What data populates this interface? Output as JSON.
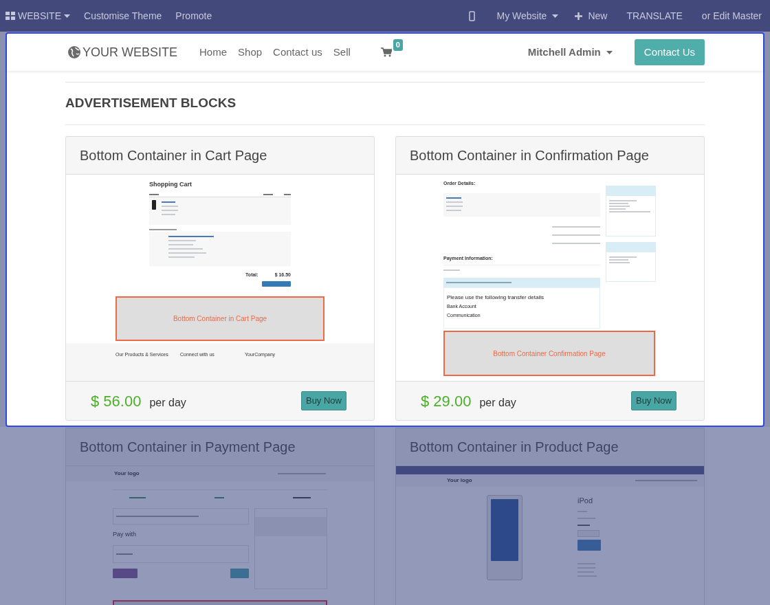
{
  "editor_bar": {
    "app_menu": "WEBSITE",
    "left_items": [
      "Customise Theme",
      "Promote"
    ],
    "website_menu": "My Website",
    "new_button": "New",
    "translate_button": "TRANSLATE",
    "edit_master": "or Edit Master"
  },
  "navbar": {
    "logo": "YOUR WEBSITE",
    "links": [
      "Home",
      "Shop",
      "Contact us",
      "Sell"
    ],
    "cart_count": "0",
    "user": "Mitchell Admin",
    "cta": "Contact Us"
  },
  "section_title": "ADVERTISEMENT BLOCKS",
  "cards": [
    {
      "title": "Bottom Container in Cart Page",
      "price": "$ 56.00",
      "unit": "per day",
      "button": "Buy Now",
      "highlighted": true,
      "preview": {
        "kind": "cart",
        "heading": "Shopping Cart",
        "total_label": "Total:",
        "total": "$ 16.50",
        "ad_label": "Bottom Container in Cart Page",
        "footer": [
          "Our Products & Services",
          "Connect with us",
          "YourCompany"
        ]
      }
    },
    {
      "title": "Bottom Container in Confirmation Page",
      "price": "$ 29.00",
      "unit": "per day",
      "button": "Buy Now",
      "highlighted": true,
      "preview": {
        "kind": "confirmation",
        "heading": "Order Details:",
        "payment_heading": "Payment Information:",
        "transfer_heading": "Please use the following transfer details",
        "transfer_lines": [
          "Bank Account",
          "Communication"
        ],
        "ad_label": "Bottom Container Confirmation Page"
      }
    },
    {
      "title": "Bottom Container in Payment Page",
      "highlighted": false,
      "preview": {
        "kind": "payment",
        "logo": "Your logo",
        "pay_heading": "Pay with"
      }
    },
    {
      "title": "Bottom Container in Product Page",
      "highlighted": false,
      "preview": {
        "kind": "product",
        "logo": "Your logo",
        "product": "iPod"
      }
    }
  ]
}
